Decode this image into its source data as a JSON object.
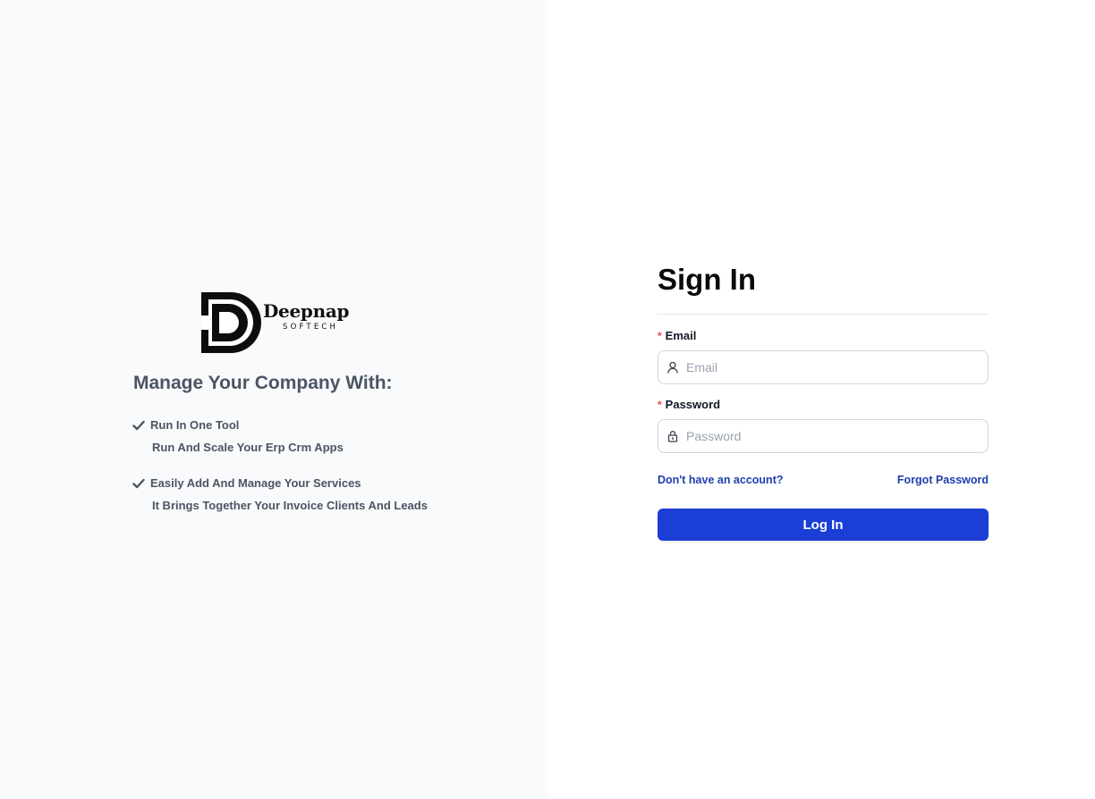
{
  "brand": {
    "name": "Deepnap",
    "sub": "SOFTECH"
  },
  "left": {
    "tagline": "Manage Your Company With:",
    "features": [
      {
        "title": "Run In One Tool",
        "desc": "Run And Scale Your Erp Crm Apps"
      },
      {
        "title": "Easily Add And Manage Your Services",
        "desc": "It Brings Together Your Invoice Clients And Leads"
      }
    ]
  },
  "form": {
    "title": "Sign In",
    "required_mark": "*",
    "email": {
      "label": "Email",
      "placeholder": "Email",
      "value": ""
    },
    "password": {
      "label": "Password",
      "placeholder": "Password",
      "value": ""
    },
    "signup_link": "Don't have an account?",
    "forgot_link": "Forgot Password",
    "submit_label": "Log In"
  },
  "colors": {
    "left_bg": "#f8fafc",
    "accent": "#1a3ed6",
    "link": "#1e40af",
    "required": "#ef4444"
  },
  "icons": [
    "check-icon",
    "user-icon",
    "lock-icon",
    "logo-mark"
  ]
}
